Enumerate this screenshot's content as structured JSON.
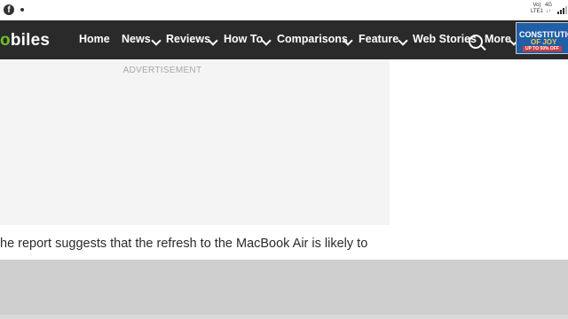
{
  "status_bar": {
    "network_top": "Vo)",
    "network_bottom": "LTE1",
    "network_type": "4G",
    "arrows": "↓↑"
  },
  "logo": {
    "prefix": "",
    "accent": "o",
    "rest": "biles"
  },
  "nav": {
    "items": [
      {
        "label": "Home"
      },
      {
        "label": "News"
      },
      {
        "label": "Reviews"
      },
      {
        "label": "How To"
      },
      {
        "label": "Comparisons"
      },
      {
        "label": "Feature"
      },
      {
        "label": "Web Stories"
      },
      {
        "label": "More"
      }
    ]
  },
  "ad_banner": {
    "line1": "CONSTITUTION",
    "line2": "OF JOY",
    "offer": "UP TO 50% OFF"
  },
  "advertisement": {
    "label": "ADVERTISEMENT"
  },
  "article": {
    "text": "he report suggests that the refresh to the MacBook Air is likely to"
  },
  "colors": {
    "nav_bg": "#2a2a2a",
    "logo_accent": "#6fbf2a",
    "ad_bg": "#f4f4f4"
  }
}
